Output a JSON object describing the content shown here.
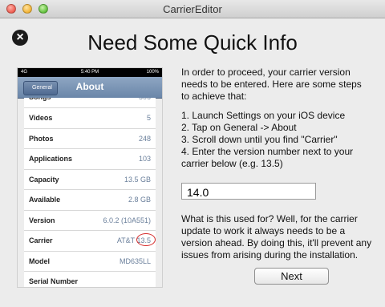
{
  "window": {
    "title": "CarrierEditor"
  },
  "heading": "Need Some Quick Info",
  "phone": {
    "status": {
      "carrier": "4G",
      "time": "5:40 PM",
      "battery": "100%"
    },
    "back_label": "General",
    "title": "About",
    "rows": [
      {
        "key": "Songs",
        "value": "506"
      },
      {
        "key": "Videos",
        "value": "5"
      },
      {
        "key": "Photos",
        "value": "248"
      },
      {
        "key": "Applications",
        "value": "103"
      },
      {
        "key": "Capacity",
        "value": "13.5 GB"
      },
      {
        "key": "Available",
        "value": "2.8 GB"
      },
      {
        "key": "Version",
        "value": "6.0.2 (10A551)"
      },
      {
        "key": "Carrier",
        "value": "AT&T 13.5"
      },
      {
        "key": "Model",
        "value": "MD635LL"
      },
      {
        "key": "Serial Number",
        "value": ""
      }
    ]
  },
  "instructions": {
    "intro": "In order to proceed, your carrier version needs to be entered. Here are some steps to achieve that:",
    "steps": [
      "1. Launch Settings on your iOS device",
      "2. Tap on General -> About",
      "3. Scroll down until you find \"Carrier\"",
      "4. Enter the version number next to your carrier below (e.g. 13.5)"
    ],
    "why": "What is this used for? Well, for the carrier update to work it always needs to be a version ahead. By doing this, it'll prevent any issues from arising during the installation."
  },
  "version_input": {
    "value": "14.0"
  },
  "next_label": "Next"
}
